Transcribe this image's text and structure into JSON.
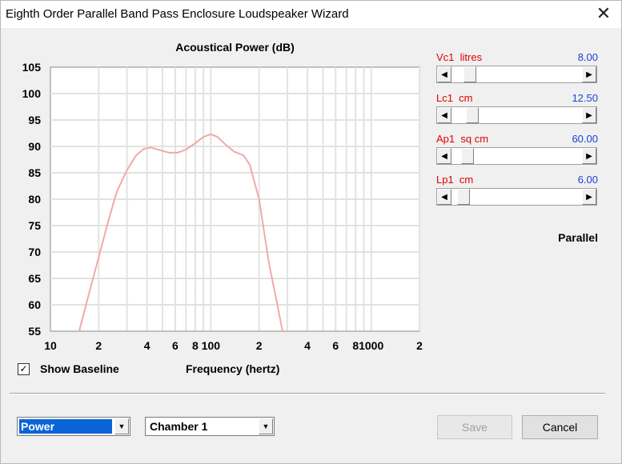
{
  "window": {
    "title": "Eighth Order Parallel Band Pass Enclosure Loudspeaker Wizard",
    "close_glyph": "✕"
  },
  "chart_data": {
    "type": "line",
    "title": "Acoustical Power (dB)",
    "xlabel": "Frequency (hertz)",
    "ylabel": "",
    "xscale": "log",
    "xlim": [
      10,
      2000
    ],
    "ylim": [
      55,
      105
    ],
    "grid": true,
    "y_ticks": [
      "105",
      "100",
      "95",
      "90",
      "85",
      "80",
      "75",
      "70",
      "65",
      "60",
      "55"
    ],
    "x_ticks": [
      {
        "value": 10,
        "label": "10"
      },
      {
        "value": 20,
        "label": "2"
      },
      {
        "value": 40,
        "label": "4"
      },
      {
        "value": 60,
        "label": "6"
      },
      {
        "value": 80,
        "label": "8"
      },
      {
        "value": 100,
        "label": "100"
      },
      {
        "value": 200,
        "label": "2"
      },
      {
        "value": 400,
        "label": "4"
      },
      {
        "value": 600,
        "label": "6"
      },
      {
        "value": 800,
        "label": "8"
      },
      {
        "value": 1000,
        "label": "1000"
      },
      {
        "value": 2000,
        "label": "2"
      }
    ],
    "series": [
      {
        "color": "#f4a8a8",
        "points": [
          [
            15.1,
            55
          ],
          [
            17,
            61
          ],
          [
            20,
            69
          ],
          [
            23,
            76
          ],
          [
            26,
            81.5
          ],
          [
            30,
            85.5
          ],
          [
            34,
            88.2
          ],
          [
            38,
            89.5
          ],
          [
            42,
            89.8
          ],
          [
            48,
            89.3
          ],
          [
            55,
            88.8
          ],
          [
            62,
            88.8
          ],
          [
            70,
            89.4
          ],
          [
            80,
            90.6
          ],
          [
            90,
            91.8
          ],
          [
            100,
            92.3
          ],
          [
            110,
            91.8
          ],
          [
            125,
            90.2
          ],
          [
            140,
            89.0
          ],
          [
            160,
            88.3
          ],
          [
            175,
            86.5
          ],
          [
            200,
            80
          ],
          [
            230,
            68
          ],
          [
            260,
            60
          ],
          [
            280,
            55
          ]
        ]
      }
    ]
  },
  "params": [
    {
      "label": "Vc1  litres",
      "value": "8.00",
      "position": 0.1
    },
    {
      "label": "Lc1  cm",
      "value": "12.50",
      "position": 0.125
    },
    {
      "label": "Ap1  sq cm",
      "value": "60.00",
      "position": 0.08
    },
    {
      "label": "Lp1  cm",
      "value": "6.00",
      "position": 0.05
    }
  ],
  "mode_label": "Parallel",
  "show_baseline": {
    "label": "Show Baseline",
    "checked": true,
    "check_glyph": "✓"
  },
  "view_select": {
    "value": "Power",
    "arrow": "▼"
  },
  "chamber_select": {
    "value": "Chamber 1",
    "arrow": "▼"
  },
  "buttons": {
    "save": "Save",
    "cancel": "Cancel"
  },
  "scroll_arrows": {
    "left": "◀",
    "right": "▶"
  }
}
